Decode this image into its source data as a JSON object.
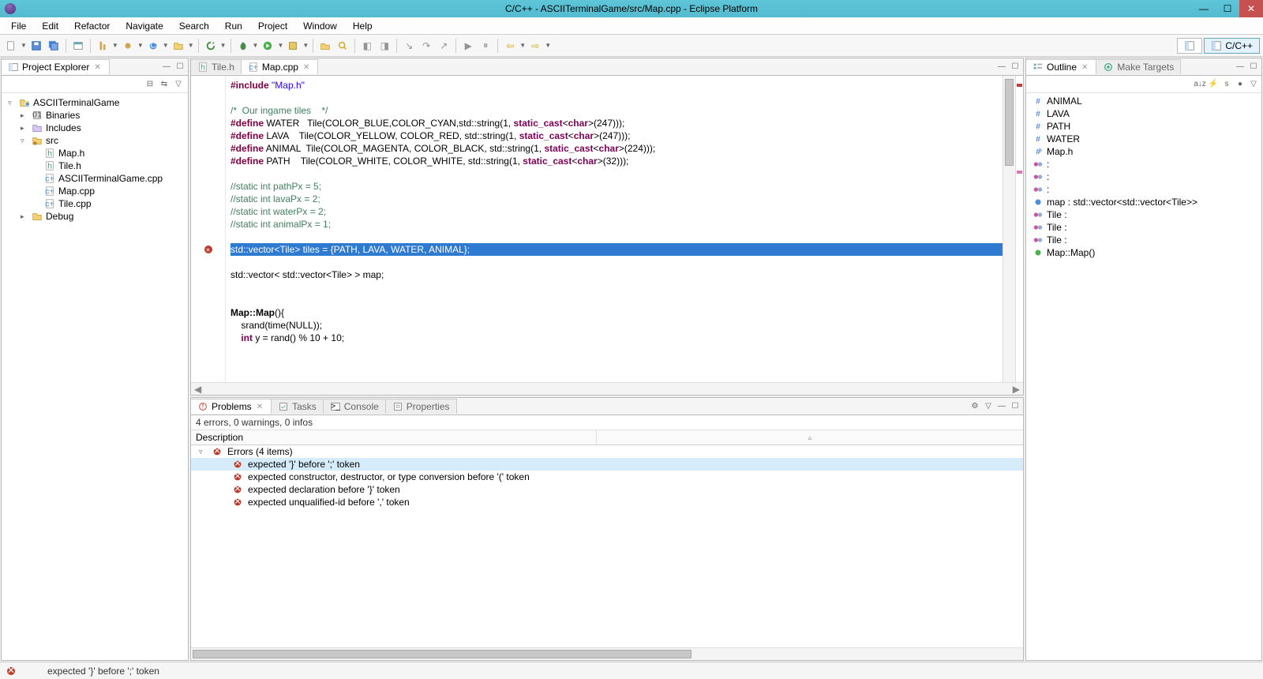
{
  "title": "C/C++ - ASCIITerminalGame/src/Map.cpp - Eclipse Platform",
  "menu": [
    "File",
    "Edit",
    "Refactor",
    "Navigate",
    "Search",
    "Run",
    "Project",
    "Window",
    "Help"
  ],
  "perspective_label": "C/C++",
  "project_explorer": {
    "title": "Project Explorer",
    "root": "ASCIITerminalGame",
    "children": [
      {
        "label": "Binaries"
      },
      {
        "label": "Includes"
      },
      {
        "label": "src",
        "children": [
          "Map.h",
          "Tile.h",
          "ASCIITerminalGame.cpp",
          "Map.cpp",
          "Tile.cpp"
        ]
      },
      {
        "label": "Debug"
      }
    ]
  },
  "editor": {
    "tabs": [
      {
        "label": "Tile.h",
        "active": false
      },
      {
        "label": "Map.cpp",
        "active": true
      }
    ],
    "error_line_index": 13,
    "lines": [
      {
        "html": "<span class=\"c-dir\">#include</span> <span class=\"c-str\">\"Map.h\"</span>"
      },
      {
        "html": ""
      },
      {
        "html": "<span class=\"c-cmt\">/*  Our ingame tiles    */</span>"
      },
      {
        "html": "<span class=\"c-dir\">#define</span> WATER   Tile(COLOR_BLUE,COLOR_CYAN,std::string(1, <span class=\"c-kwd\">static_cast</span>&lt;<span class=\"c-kwd\">char</span>&gt;(247)));"
      },
      {
        "html": "<span class=\"c-dir\">#define</span> LAVA    Tile(COLOR_YELLOW, COLOR_RED, std::string(1, <span class=\"c-kwd\">static_cast</span>&lt;<span class=\"c-kwd\">char</span>&gt;(247)));"
      },
      {
        "html": "<span class=\"c-dir\">#define</span> ANIMAL  Tile(COLOR_MAGENTA, COLOR_BLACK, std::string(1, <span class=\"c-kwd\">static_cast</span>&lt;<span class=\"c-kwd\">char</span>&gt;(224)));"
      },
      {
        "html": "<span class=\"c-dir\">#define</span> PATH    Tile(COLOR_WHITE, COLOR_WHITE, std::string(1, <span class=\"c-kwd\">static_cast</span>&lt;<span class=\"c-kwd\">char</span>&gt;(32)));"
      },
      {
        "html": ""
      },
      {
        "html": "<span class=\"c-cmt\">//static int pathPx = 5;</span>"
      },
      {
        "html": "<span class=\"c-cmt\">//static int lavaPx = 2;</span>"
      },
      {
        "html": "<span class=\"c-cmt\">//static int waterPx = 2;</span>"
      },
      {
        "html": "<span class=\"c-cmt\">//static int animalPx = 1;</span>"
      },
      {
        "html": ""
      },
      {
        "html": "std::vector&lt;Tile&gt; tiles = {PATH, LAVA, WATER, ANIMAL};",
        "selected": true
      },
      {
        "html": ""
      },
      {
        "html": "std::vector&lt; std::vector&lt;Tile&gt; &gt; map;"
      },
      {
        "html": ""
      },
      {
        "html": ""
      },
      {
        "html": "<span class=\"c-bold\">Map::Map</span>(){"
      },
      {
        "html": "    srand(time(NULL));"
      },
      {
        "html": "    <span class=\"c-kwd\">int</span> y = rand() % 10 + 10;"
      }
    ]
  },
  "outline": {
    "title": "Outline",
    "other_tab": "Make Targets",
    "items": [
      {
        "icon": "hash",
        "label": "ANIMAL"
      },
      {
        "icon": "hash",
        "label": "LAVA"
      },
      {
        "icon": "hash",
        "label": "PATH"
      },
      {
        "icon": "hash",
        "label": "WATER"
      },
      {
        "icon": "inc",
        "label": "Map.h"
      },
      {
        "icon": "var",
        "label": ":"
      },
      {
        "icon": "var",
        "label": ":"
      },
      {
        "icon": "var",
        "label": ":"
      },
      {
        "icon": "field",
        "label": "map : std::vector<std::vector<Tile>>"
      },
      {
        "icon": "var",
        "label": "Tile :"
      },
      {
        "icon": "var",
        "label": "Tile :"
      },
      {
        "icon": "var",
        "label": "Tile :"
      },
      {
        "icon": "method",
        "label": "Map::Map()"
      }
    ]
  },
  "bottom": {
    "tabs": [
      "Problems",
      "Tasks",
      "Console",
      "Properties"
    ],
    "active_tab": 0,
    "status": "4 errors, 0 warnings, 0 infos",
    "header_col": "Description",
    "group_label": "Errors (4 items)",
    "errors": [
      "expected '}' before ';' token",
      "expected constructor, destructor, or type conversion before '(' token",
      "expected declaration before '}' token",
      "expected unqualified-id before ',' token"
    ]
  },
  "statusbar": {
    "icon": "error",
    "message": "expected '}' before ';' token"
  }
}
